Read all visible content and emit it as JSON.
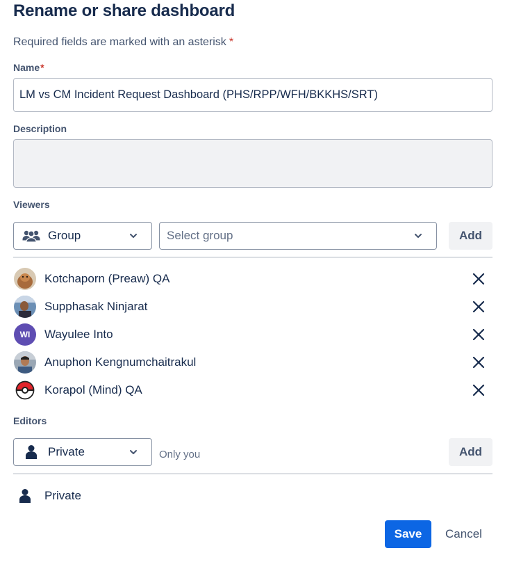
{
  "dialog": {
    "title": "Rename or share dashboard",
    "required_note": "Required fields are marked with an asterisk",
    "required_mark": "*"
  },
  "name_field": {
    "label": "Name",
    "value": "LM vs CM Incident Request Dashboard (PHS/RPP/WFH/BKKHS/SRT)"
  },
  "description_field": {
    "label": "Description",
    "value": ""
  },
  "viewers": {
    "label": "Viewers",
    "type_select": {
      "value": "Group",
      "icon": "group-icon"
    },
    "group_select": {
      "placeholder": "Select group"
    },
    "add_label": "Add",
    "list": [
      {
        "name": "Kotchaporn (Preaw) QA",
        "avatar": "photo-dog"
      },
      {
        "name": "Supphasak Ninjarat",
        "avatar": "photo-person"
      },
      {
        "name": "Wayulee Into",
        "avatar": "initials",
        "initials": "WI",
        "avatar_color": "#5e4db2"
      },
      {
        "name": "Anuphon Kengnumchaitrakul",
        "avatar": "photo-person"
      },
      {
        "name": "Korapol (Mind) QA",
        "avatar": "pokeball"
      }
    ]
  },
  "editors": {
    "label": "Editors",
    "type_select": {
      "value": "Private",
      "icon": "person-icon"
    },
    "hint": "Only you",
    "add_label": "Add",
    "list": [
      {
        "name": "Private",
        "icon": "person-icon"
      }
    ]
  },
  "footer": {
    "save_label": "Save",
    "cancel_label": "Cancel"
  },
  "colors": {
    "primary": "#0c66e4",
    "text": "#172b4d",
    "required": "#c9372c"
  }
}
